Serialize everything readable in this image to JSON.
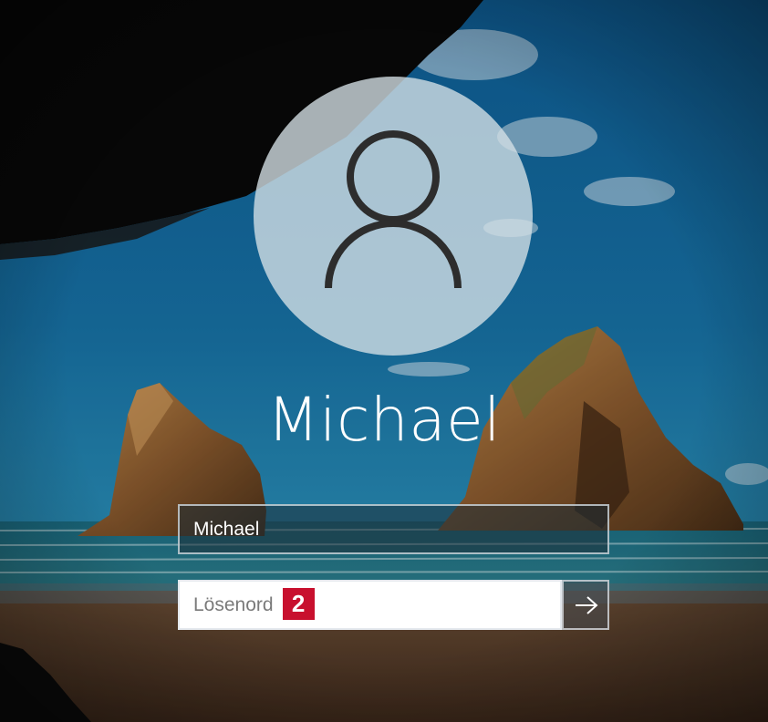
{
  "user": {
    "display_name": "Michael"
  },
  "form": {
    "username_value": "Michael",
    "password_placeholder": "Lösenord",
    "annotation_number": "2"
  },
  "icons": {
    "avatar": "user-silhouette-icon",
    "submit": "arrow-right-icon"
  },
  "colors": {
    "annotation_badge": "#c8102e",
    "text": "#ffffff"
  }
}
